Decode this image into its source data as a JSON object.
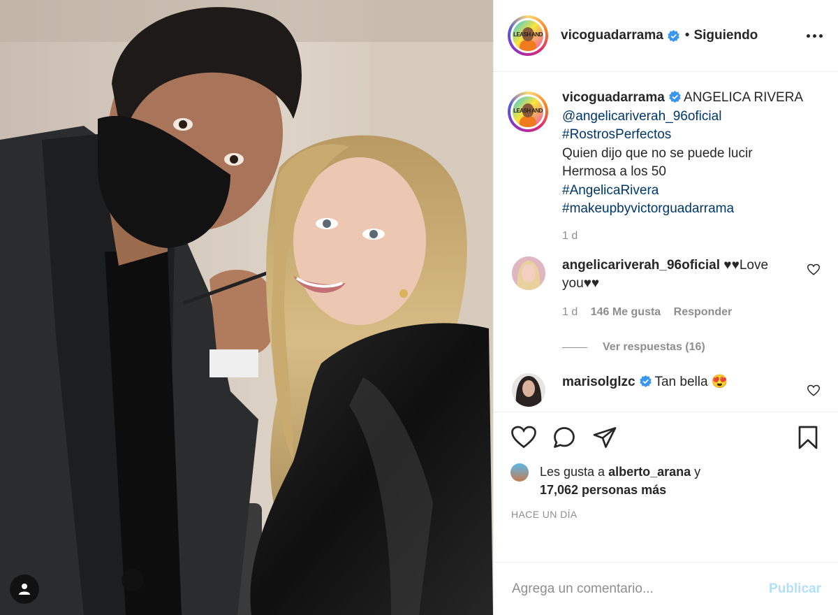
{
  "post": {
    "author": "vicoguadarrama",
    "follow_state": "Siguiendo",
    "separator": "•",
    "avatar_text": "LEASH AND"
  },
  "caption": {
    "author": "vicoguadarrama",
    "title": "ANGELICA RIVERA",
    "mention": "@angelicariverah_96oficial",
    "hashtag1": "#RostrosPerfectos",
    "line1": "Quien dijo que no se puede lucir",
    "line2": "Hermosa a los 50",
    "hashtag2": "#AngelicaRivera",
    "hashtag3": "#makeupbyvictorguadarrama",
    "time": "1 d"
  },
  "comments": [
    {
      "author": "angelicariverah_96oficial",
      "text": "♥♥Love you♥♥",
      "time": "1 d",
      "likes": "146 Me gusta",
      "reply": "Responder",
      "view_replies": "Ver respuestas (16)"
    },
    {
      "author": "marisolglzc",
      "text": "Tan bella 😍"
    }
  ],
  "likes": {
    "prefix": "Les gusta a",
    "user": "alberto_arana",
    "conj": "y",
    "count": "17,062 personas más"
  },
  "timestamp": "HACE UN DÍA",
  "comment_input": {
    "placeholder": "Agrega un comentario...",
    "publish": "Publicar"
  },
  "colors": {
    "text": "#262626",
    "muted": "#8e8e8e",
    "link": "#00376b",
    "verified": "#3897f0",
    "publish_disabled": "#b2dffc"
  },
  "icons": [
    "heart-icon",
    "comment-icon",
    "share-icon",
    "bookmark-icon",
    "user-tag-icon",
    "more-icon",
    "verified-icon"
  ]
}
